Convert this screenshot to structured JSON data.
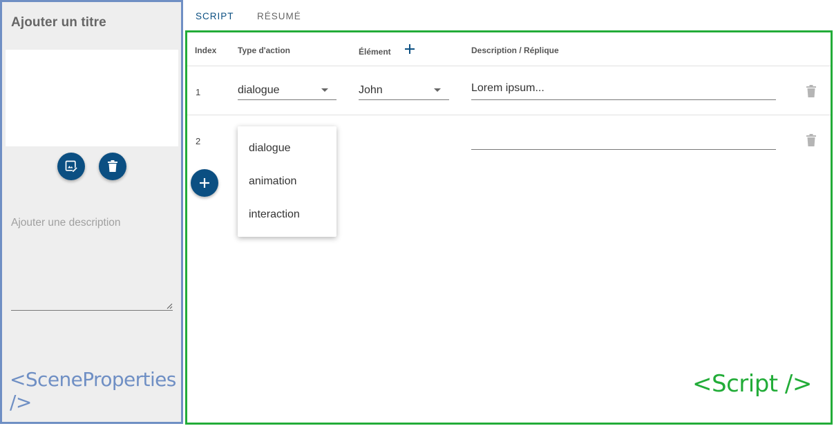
{
  "scene": {
    "title_placeholder": "Ajouter un titre",
    "description_placeholder": "Ajouter une description",
    "caption": "<SceneProperties />"
  },
  "tabs": [
    {
      "label": "SCRIPT",
      "active": true
    },
    {
      "label": "RÉSUMÉ",
      "active": false
    }
  ],
  "table": {
    "headers": {
      "index": "Index",
      "type": "Type d'action",
      "element": "Élément",
      "description": "Description / Réplique"
    },
    "rows": [
      {
        "index": "1",
        "type": "dialogue",
        "element": "John",
        "description": "Lorem ipsum..."
      },
      {
        "index": "2",
        "type": "",
        "element": "",
        "description": ""
      }
    ]
  },
  "dropdown": {
    "options": [
      "dialogue",
      "animation",
      "interaction"
    ]
  },
  "script_caption": "<Script />",
  "icons": {
    "edit_image": "edit-image-icon",
    "delete_image": "trash-icon",
    "add_element": "plus-icon",
    "add_row": "plus-icon",
    "delete_row": "trash-icon"
  },
  "colors": {
    "primary": "#0b4f82",
    "scene_border": "#6f8fc4",
    "script_border": "#22ac38"
  }
}
